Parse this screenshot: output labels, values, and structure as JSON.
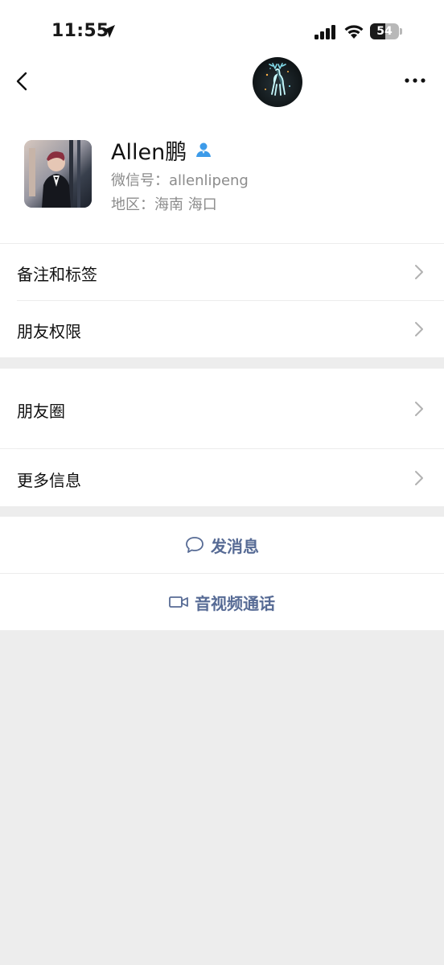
{
  "status_bar": {
    "time": "11:55",
    "battery": "54",
    "battery_level": 0.54,
    "icons": [
      "location-arrow-icon",
      "cellular-signal-icon",
      "wifi-icon",
      "battery-icon"
    ]
  },
  "nav": {
    "back_icon": "chevron-left-icon",
    "more_icon": "ellipsis-icon",
    "avatar_icon": "glowing-deer-avatar"
  },
  "profile": {
    "name": "Allen鹏",
    "wechat_id": "微信号：allenlipeng",
    "region": "地区：海南 海口",
    "badge_icon": "contact-person-icon"
  },
  "menu": {
    "remark_tags": "备注和标签",
    "friend_permissions": "朋友权限",
    "moments": "朋友圈",
    "more_info": "更多信息"
  },
  "actions": {
    "send_message": "发消息",
    "video_call": "音视频通话"
  },
  "colors": {
    "link_blue": "#576b95",
    "background_gray": "#ededed",
    "badge_blue": "#3d9be9"
  }
}
